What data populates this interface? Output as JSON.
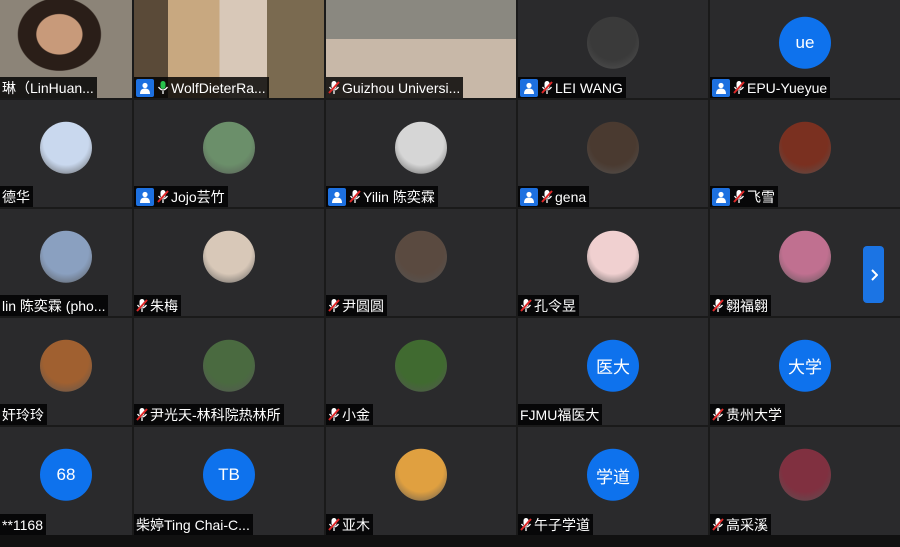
{
  "participants": [
    {
      "name": "琳（LinHuan...",
      "type": "video",
      "host": false,
      "mic": "none"
    },
    {
      "name": "WolfDieterRa...",
      "type": "video",
      "host": true,
      "mic": "active",
      "active": true
    },
    {
      "name": "Guizhou Universi...",
      "type": "video",
      "host": false,
      "mic": "muted"
    },
    {
      "name": "LEI WANG",
      "type": "pic",
      "host": true,
      "mic": "muted",
      "avatar_color": "#3a3a3a"
    },
    {
      "name": "EPU-Yueyue",
      "type": "initials",
      "initials": "ue",
      "host": true,
      "mic": "muted"
    },
    {
      "name": "德华",
      "type": "pic",
      "host": false,
      "mic": "none",
      "avatar_color": "#c9d8ee"
    },
    {
      "name": "Jojo芸竹",
      "type": "pic",
      "host": true,
      "mic": "muted",
      "avatar_color": "#6b8f6a"
    },
    {
      "name": "Yilin 陈奕霖",
      "type": "pic",
      "host": true,
      "mic": "muted",
      "avatar_color": "#d6d6d6"
    },
    {
      "name": "gena",
      "type": "pic",
      "host": true,
      "mic": "muted",
      "avatar_color": "#4a3a30"
    },
    {
      "name": "飞雪",
      "type": "pic",
      "host": true,
      "mic": "muted",
      "avatar_color": "#7a3020"
    },
    {
      "name": "lin 陈奕霖 (pho...",
      "type": "pic",
      "host": false,
      "mic": "none",
      "avatar_color": "#8aa0c0"
    },
    {
      "name": "朱梅",
      "type": "pic",
      "host": false,
      "mic": "muted",
      "avatar_color": "#d8c8b8"
    },
    {
      "name": "尹圆圆",
      "type": "pic",
      "host": false,
      "mic": "muted",
      "avatar_color": "#5a4a40"
    },
    {
      "name": "孔令昱",
      "type": "pic",
      "host": false,
      "mic": "muted",
      "avatar_color": "#f0d0d0"
    },
    {
      "name": "翱福翱",
      "type": "pic",
      "host": false,
      "mic": "muted",
      "avatar_color": "#c07090"
    },
    {
      "name": "奸玲玲",
      "type": "pic",
      "host": false,
      "mic": "none",
      "avatar_color": "#a06030"
    },
    {
      "name": "尹光天-林科院热林所",
      "type": "pic",
      "host": false,
      "mic": "muted",
      "avatar_color": "#4a6a40"
    },
    {
      "name": "小金",
      "type": "pic",
      "host": false,
      "mic": "muted",
      "avatar_color": "#406a30"
    },
    {
      "name": "FJMU福医大",
      "type": "initials",
      "initials": "医大",
      "host": false,
      "mic": "none"
    },
    {
      "name": "贵州大学",
      "type": "initials",
      "initials": "大学",
      "host": false,
      "mic": "muted"
    },
    {
      "name": "**1168",
      "type": "initials",
      "initials": "68",
      "host": false,
      "mic": "none"
    },
    {
      "name": "柴婷Ting Chai-C...",
      "type": "initials",
      "initials": "TB",
      "host": false,
      "mic": "none"
    },
    {
      "name": "亚木",
      "type": "pic",
      "host": false,
      "mic": "muted",
      "avatar_color": "#e0a040"
    },
    {
      "name": "午子学道",
      "type": "initials",
      "initials": "学道",
      "host": false,
      "mic": "muted"
    },
    {
      "name": "高采溪",
      "type": "pic",
      "host": false,
      "mic": "muted",
      "avatar_color": "#803040"
    }
  ],
  "colors": {
    "accent": "#0e72ed",
    "active_border": "#27c24c",
    "tile_bg": "#2a2a2c"
  },
  "icons": {
    "host": "person-icon",
    "mic_muted": "mic-muted-icon",
    "mic_active": "mic-active-icon",
    "next": "chevron-right-icon"
  }
}
